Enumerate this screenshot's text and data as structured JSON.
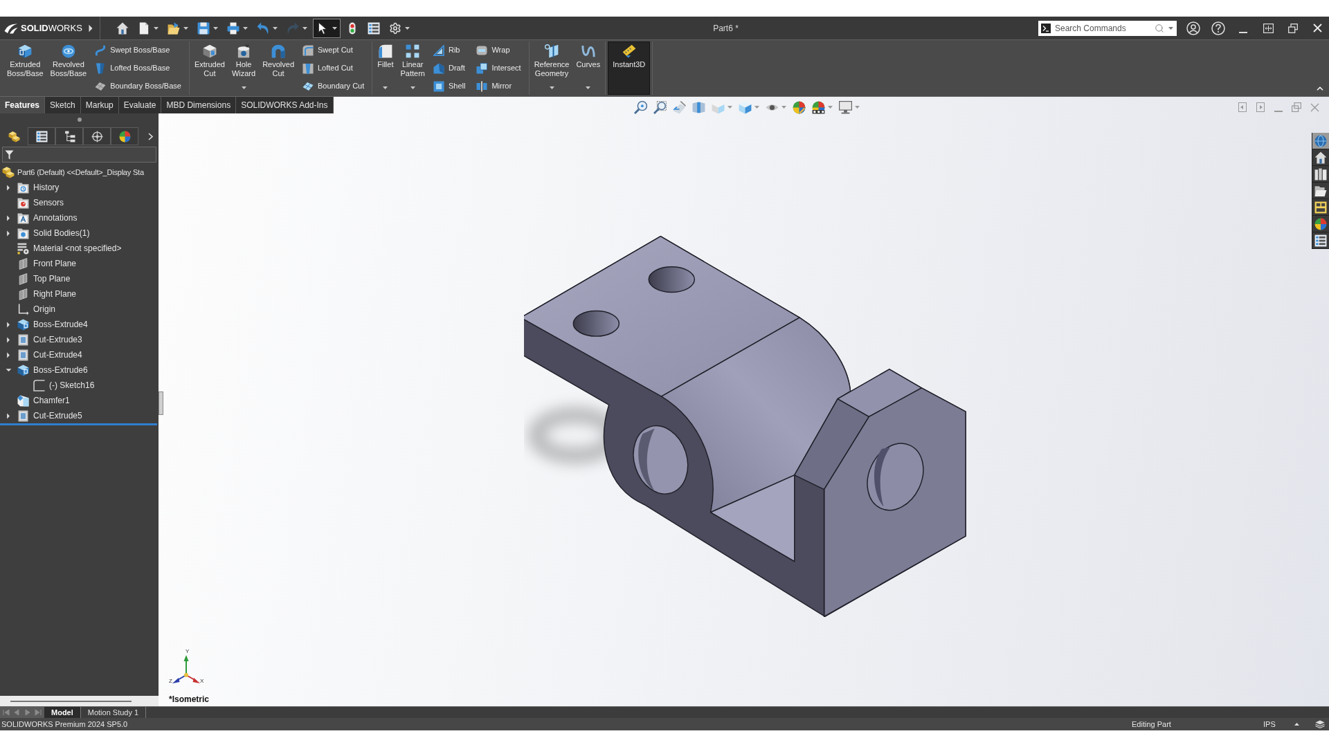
{
  "title_bar": {
    "logo_text": "**SOLID**WORKS",
    "document_title": "Part6 *",
    "search": {
      "placeholder": "Search Commands"
    }
  },
  "quick_access": [
    {
      "dropdown": false,
      "disabled": false,
      "on": false
    },
    {
      "dropdown": true,
      "disabled": false,
      "on": false
    },
    {
      "dropdown": true,
      "disabled": false,
      "on": false
    },
    {
      "dropdown": true,
      "disabled": false,
      "on": false
    },
    {
      "dropdown": true,
      "disabled": false,
      "on": false
    },
    {
      "dropdown": true,
      "disabled": false,
      "on": false
    },
    {
      "dropdown": true,
      "disabled": true,
      "on": false
    },
    {
      "dropdown": true,
      "disabled": false,
      "on": true
    },
    {
      "dropdown": false,
      "disabled": false,
      "on": false
    },
    {
      "dropdown": false,
      "disabled": false,
      "on": false
    },
    {
      "dropdown": true,
      "disabled": false,
      "on": false
    }
  ],
  "ribbon": {
    "groups": [
      {
        "items": [
          {
            "kind": "large",
            "label": "Extruded Boss/Base",
            "dropdown": false,
            "on": false
          },
          {
            "kind": "large",
            "label": "Revolved Boss/Base",
            "dropdown": false,
            "on": false
          },
          {
            "kind": "stack",
            "items": [
              {
                "label": "Swept Boss/Base",
                "on": false
              },
              {
                "label": "Lofted Boss/Base",
                "on": false
              },
              {
                "label": "Boundary Boss/Base",
                "on": false
              }
            ]
          }
        ]
      },
      {
        "items": [
          {
            "kind": "large",
            "label": "Extruded Cut",
            "dropdown": false,
            "on": false
          },
          {
            "kind": "large",
            "label": "Hole Wizard",
            "dropdown": true,
            "on": false
          },
          {
            "kind": "large",
            "label": "Revolved Cut",
            "dropdown": false,
            "on": false
          },
          {
            "kind": "stack",
            "items": [
              {
                "label": "Swept Cut",
                "on": false
              },
              {
                "label": "Lofted Cut",
                "on": false
              },
              {
                "label": "Boundary Cut",
                "on": false
              }
            ]
          }
        ]
      },
      {
        "items": [
          {
            "kind": "large",
            "label": "Fillet",
            "dropdown": true,
            "on": false
          },
          {
            "kind": "large",
            "label": "Linear Pattern",
            "dropdown": true,
            "on": false
          },
          {
            "kind": "stack",
            "items": [
              {
                "label": "Rib",
                "on": false
              },
              {
                "label": "Draft",
                "on": false
              },
              {
                "label": "Shell",
                "on": false
              }
            ]
          },
          {
            "kind": "stack",
            "items": [
              {
                "label": "Wrap",
                "on": false
              },
              {
                "label": "Intersect",
                "on": false
              },
              {
                "label": "Mirror",
                "on": false
              }
            ]
          }
        ]
      },
      {
        "items": [
          {
            "kind": "large",
            "label": "Reference Geometry",
            "dropdown": true,
            "on": false
          },
          {
            "kind": "large",
            "label": "Curves",
            "dropdown": true,
            "on": false
          }
        ]
      },
      {
        "items": [
          {
            "kind": "large",
            "label": "Instant3D",
            "dropdown": false,
            "on": true
          }
        ]
      }
    ]
  },
  "command_tabs": [
    {
      "label": "Features",
      "selected": true
    },
    {
      "label": "Sketch",
      "selected": false
    },
    {
      "label": "Markup",
      "selected": false
    },
    {
      "label": "Evaluate",
      "selected": false
    },
    {
      "label": "MBD Dimensions",
      "selected": false
    },
    {
      "label": "SOLIDWORKS Add-Ins",
      "selected": false
    }
  ],
  "view_toolbar": [
    {
      "dropdown": false
    },
    {
      "dropdown": false
    },
    {
      "dropdown": false
    },
    {
      "dropdown": false
    },
    {
      "dropdown": true
    },
    {
      "dropdown": true
    },
    {
      "dropdown": true
    },
    {
      "dropdown": false
    },
    {
      "dropdown": true
    },
    {
      "dropdown": true
    }
  ],
  "feature_manager": {
    "tabs": [
      {
        "selected": true
      },
      {
        "selected": false
      },
      {
        "selected": false
      },
      {
        "selected": false
      },
      {
        "selected": false
      }
    ],
    "root": {
      "label": "Part6 (Default) <<Default>_Display Sta",
      "children": [
        {
          "label": "History",
          "expanded": false
        },
        {
          "label": "Sensors"
        },
        {
          "label": "Annotations",
          "expanded": false
        },
        {
          "label": "Solid Bodies(1)",
          "expanded": false
        },
        {
          "label": "Material <not specified>"
        },
        {
          "label": "Front Plane"
        },
        {
          "label": "Top Plane"
        },
        {
          "label": "Right Plane"
        },
        {
          "label": "Origin"
        },
        {
          "label": "Boss-Extrude4",
          "expanded": false
        },
        {
          "label": "Cut-Extrude3",
          "expanded": false
        },
        {
          "label": "Cut-Extrude4",
          "expanded": false
        },
        {
          "label": "Boss-Extrude6",
          "expanded": true,
          "children": [
            {
              "label": "(-) Sketch16"
            }
          ]
        },
        {
          "label": "Chamfer1"
        },
        {
          "label": "Cut-Extrude5",
          "expanded": false
        }
      ]
    }
  },
  "viewport": {
    "view_label": "*Isometric",
    "axes": {
      "x": "X",
      "y": "Y",
      "z": "Z"
    }
  },
  "task_pane": [
    {
      "selected": true
    },
    {
      "selected": false
    },
    {
      "selected": false
    },
    {
      "selected": false
    },
    {
      "selected": false
    },
    {
      "selected": false
    },
    {
      "selected": false
    }
  ],
  "model_tabs": [
    {
      "label": "Model",
      "selected": true
    },
    {
      "label": "Motion Study 1",
      "selected": false
    }
  ],
  "status_bar": {
    "product": "SOLIDWORKS Premium 2024 SP5.0",
    "mode": "Editing Part",
    "units": "IPS"
  }
}
